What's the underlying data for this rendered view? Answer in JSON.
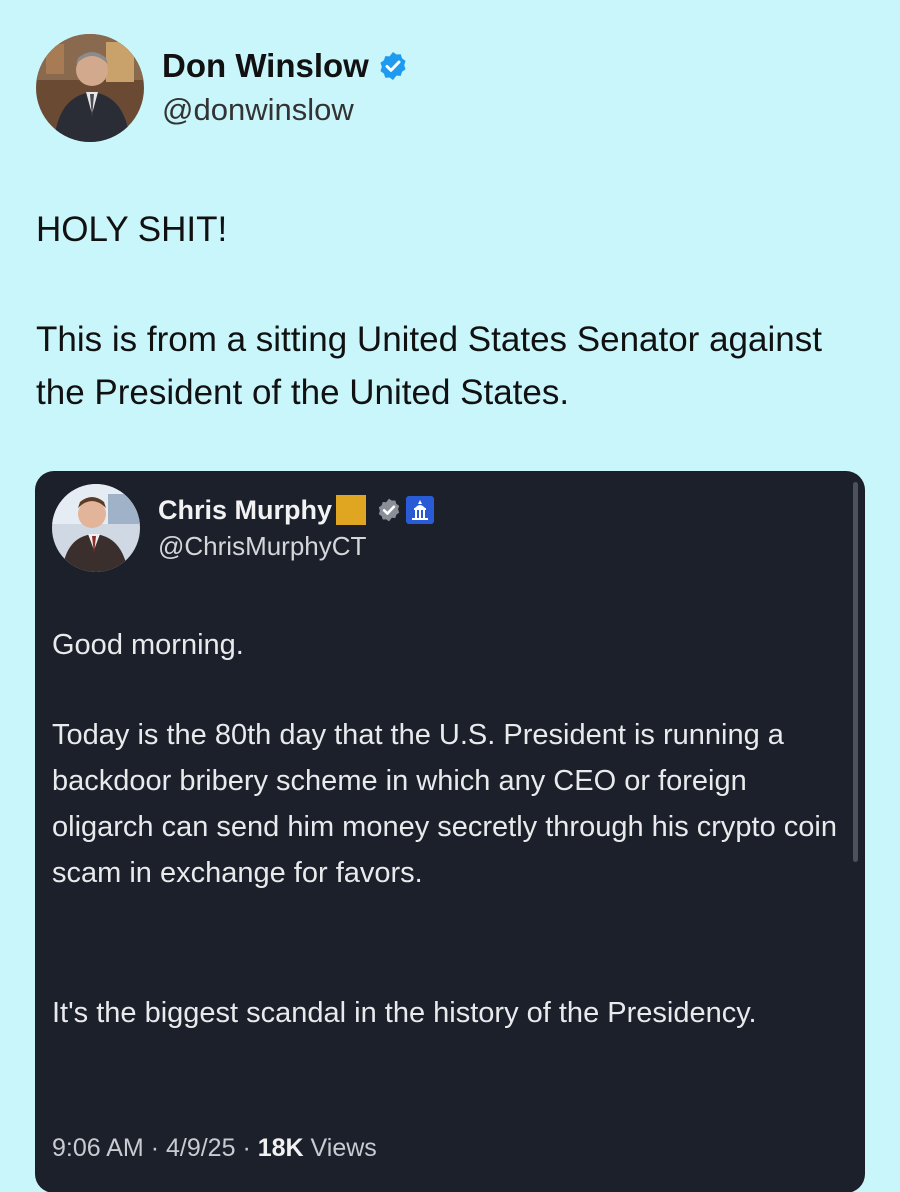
{
  "outer_tweet": {
    "author_name": "Don Winslow",
    "author_handle": "@donwinslow",
    "text_line1": "HOLY SHIT!",
    "text_line2": "This is from a sitting United States Senator against the President of the United States.",
    "verified_icon": "verified-badge-icon"
  },
  "quoted_tweet": {
    "author_name": "Chris Murphy",
    "author_handle": "@ChrisMurphyCT",
    "badges": [
      "gold-square-icon",
      "gray-verified-icon",
      "government-capitol-icon"
    ],
    "paragraph1": "Good morning.",
    "paragraph2": "Today is the 80th day that the U.S. President is running a backdoor bribery scheme in which any CEO or foreign oligarch can send him money secretly through his crypto coin scam in exchange for favors.",
    "paragraph3": "It's the biggest scandal in the history of the Presidency.",
    "time": "9:06 AM",
    "date": "4/9/25",
    "views_count": "18K",
    "views_label": "Views",
    "separator": "·"
  },
  "colors": {
    "page_background": "#c9f6fb",
    "card_background": "#1b202b",
    "verified_blue": "#1d9bf0",
    "gold_badge": "#e0a622"
  }
}
